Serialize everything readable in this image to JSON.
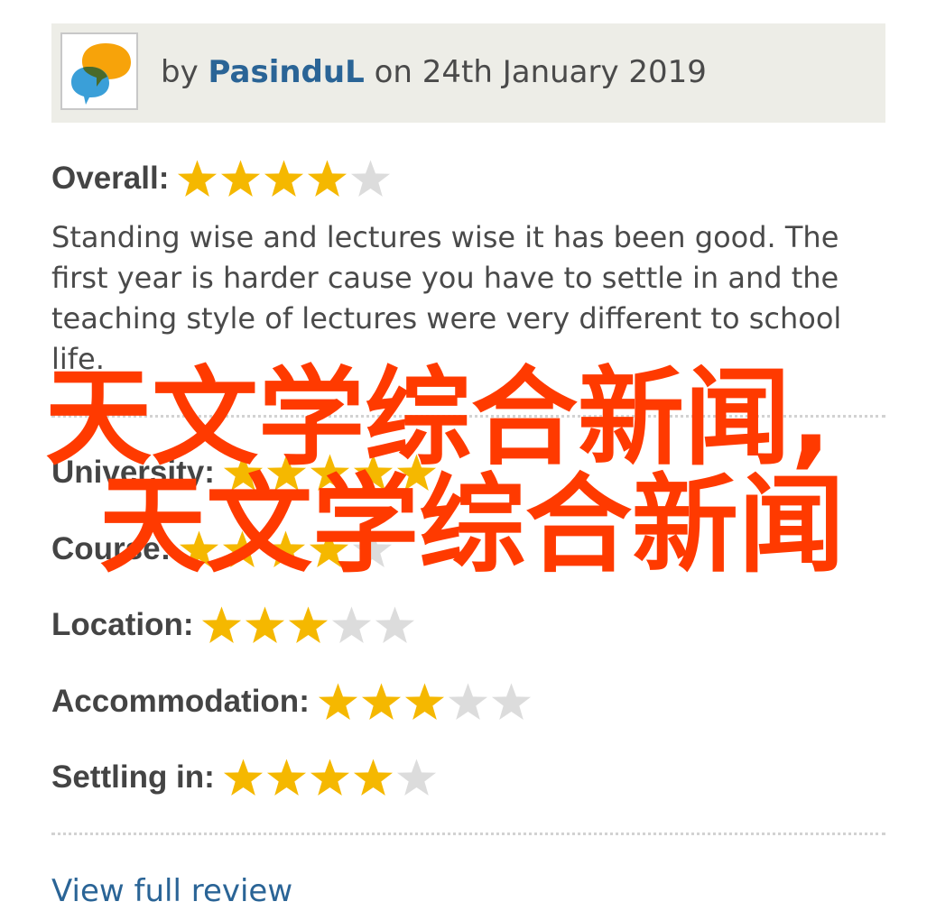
{
  "header": {
    "by_prefix": "by",
    "author": "PasinduL",
    "date_text": "on 24th January 2019",
    "avatar_icon": "speech-bubbles-icon"
  },
  "overall": {
    "label": "Overall:",
    "rating": 4,
    "max": 5
  },
  "review_text": "Standing wise and lectures wise it has been good. The first year is harder cause you have to settle in and the teaching style of lectures were very different to school life.",
  "ratings": [
    {
      "label": "University:",
      "rating": 5,
      "max": 5
    },
    {
      "label": "Course:",
      "rating": 4,
      "max": 5
    },
    {
      "label": "Location:",
      "rating": 3,
      "max": 5
    },
    {
      "label": "Accommodation:",
      "rating": 3,
      "max": 5
    },
    {
      "label": "Settling in:",
      "rating": 4,
      "max": 5
    }
  ],
  "view_full_review": "View full review",
  "watermark": {
    "line1": "天文学综合新闻,",
    "line2": "天文学综合新闻"
  },
  "colors": {
    "star_filled": "#f5b800",
    "star_empty": "#dcdcdc",
    "link": "#2a6496",
    "header_bg": "#edede7",
    "watermark": "#ff3a00"
  }
}
